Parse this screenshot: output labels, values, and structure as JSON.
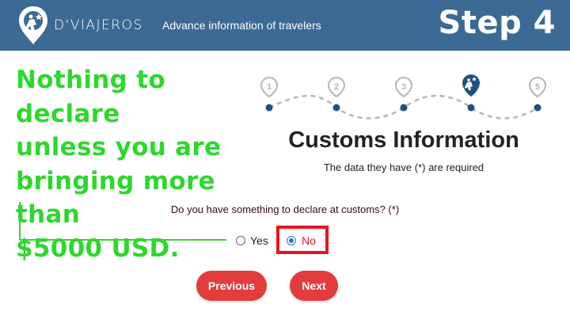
{
  "header": {
    "brand": "D'VIAJEROS",
    "tagline": "Advance information of travelers",
    "step_label": "Step 4"
  },
  "annotation": {
    "lines": [
      "Nothing to declare",
      "unless you are",
      "bringing more than",
      "$5000 USD."
    ]
  },
  "stepper": {
    "steps": [
      "1",
      "2",
      "3",
      "4",
      "5"
    ],
    "current_step": 4
  },
  "form": {
    "title": "Customs Information",
    "required_note": "The data they have (*) are required",
    "question": "Do you have something to declare at customs? (*)",
    "options": [
      {
        "label": "Yes",
        "selected": false
      },
      {
        "label": "No",
        "selected": true
      }
    ]
  },
  "buttons": {
    "previous": "Previous",
    "next": "Next"
  },
  "colors": {
    "header": "#3c6a94",
    "annotation_green": "#2ed72e",
    "button_red": "#e23c3c",
    "highlight_red": "#e8141e",
    "step_marker": "#1f5080",
    "step_pending": "#b5b5b5"
  }
}
